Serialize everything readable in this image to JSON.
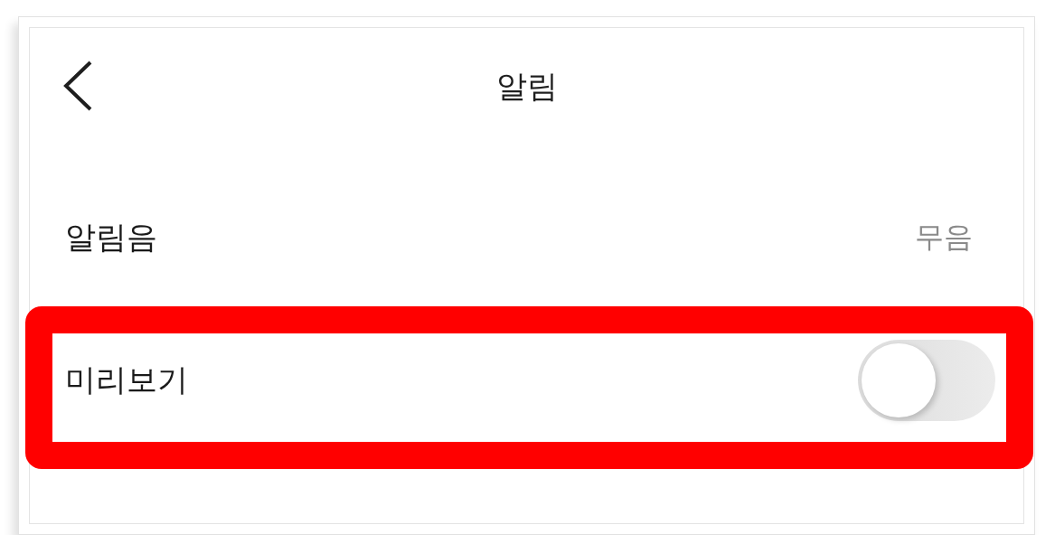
{
  "header": {
    "title": "알림"
  },
  "settings": [
    {
      "kind": "value",
      "label": "알림음",
      "value": "무음",
      "highlighted": false
    },
    {
      "kind": "toggle",
      "label": "미리보기",
      "on": false,
      "highlighted": true
    }
  ]
}
